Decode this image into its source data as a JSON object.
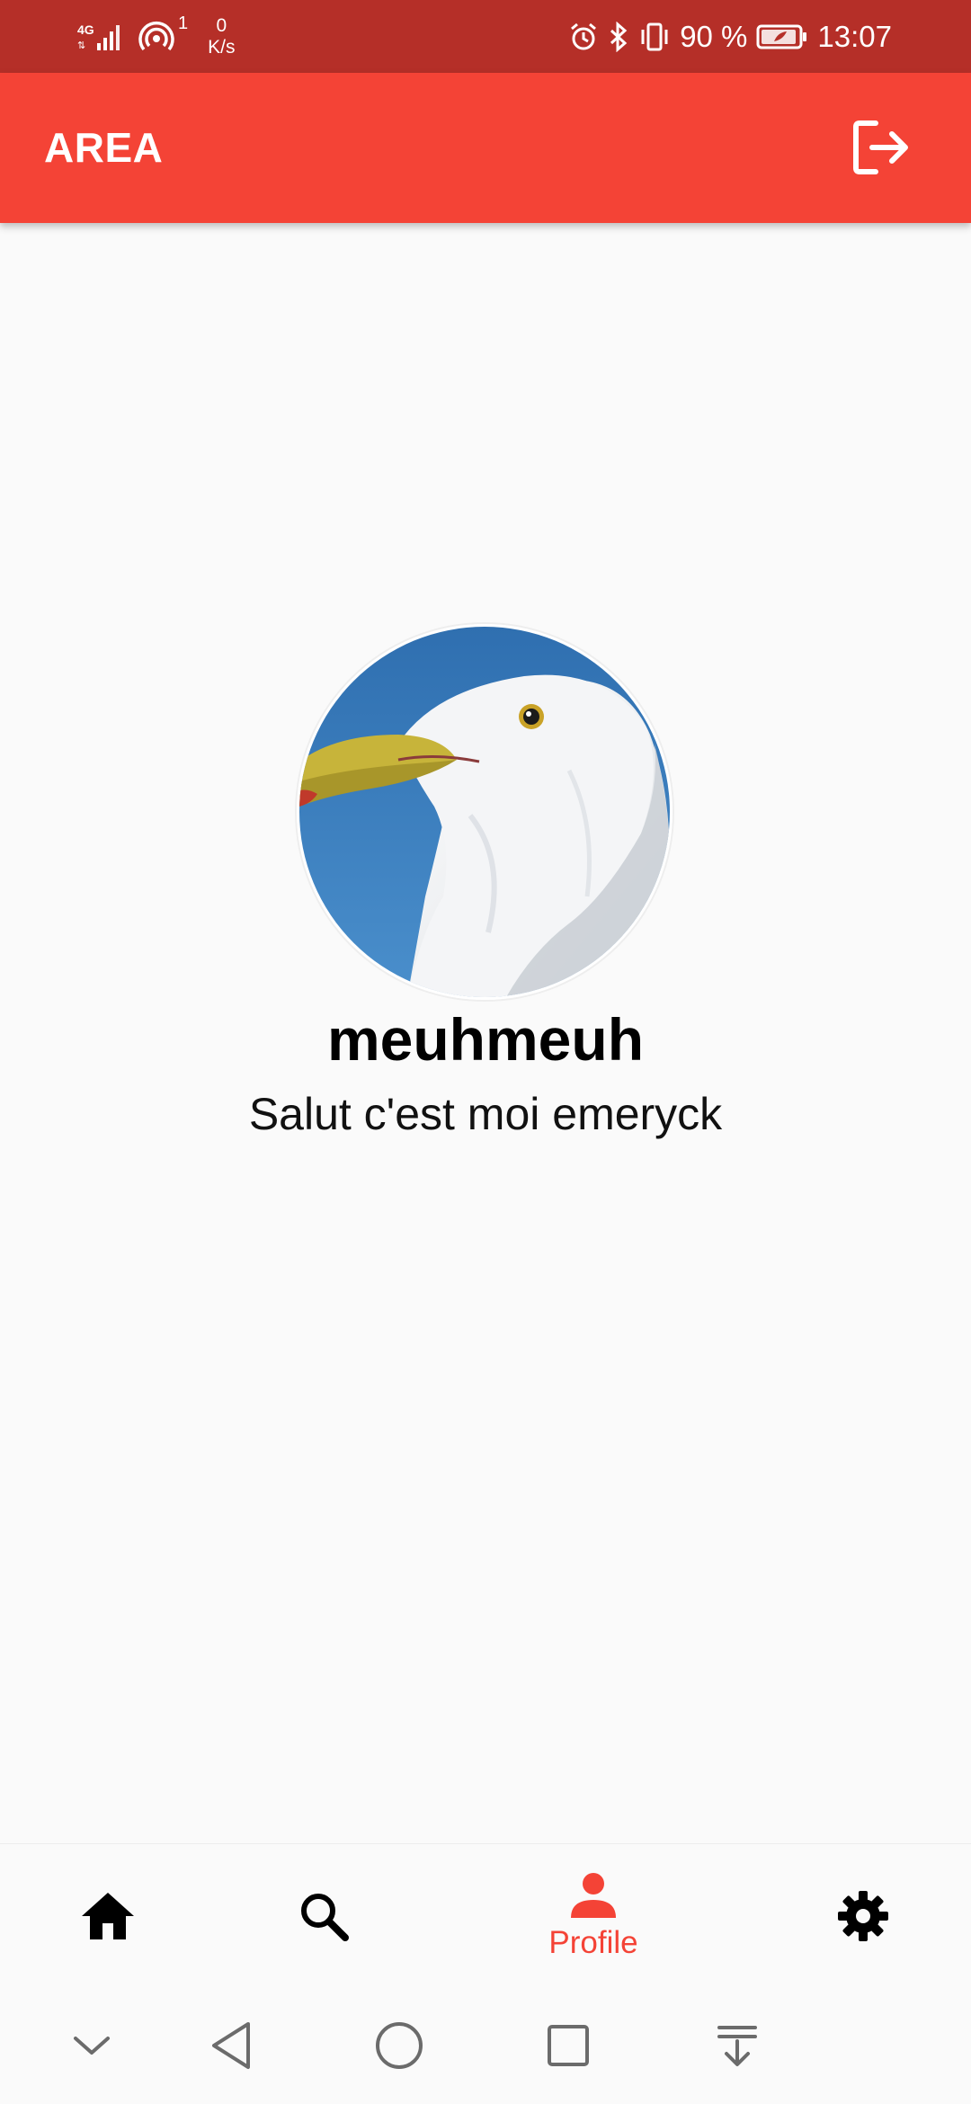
{
  "status_bar": {
    "network_type": "4G",
    "hotspot_count": "1",
    "speed_value": "0",
    "speed_unit": "K/s",
    "battery_percent": "90 %",
    "time": "13:07"
  },
  "app_bar": {
    "title": "AREA",
    "logout_icon": "logout-icon"
  },
  "profile": {
    "username": "meuhmeuh",
    "bio": "Salut c'est moi emeryck",
    "avatar_subject": "seagull"
  },
  "bottom_nav": {
    "items": [
      {
        "icon": "home-icon",
        "label": ""
      },
      {
        "icon": "search-icon",
        "label": ""
      },
      {
        "icon": "person-icon",
        "label": "Profile",
        "active": true
      },
      {
        "icon": "gear-icon",
        "label": ""
      }
    ]
  },
  "system_nav": {
    "buttons": [
      "chevron-down-icon",
      "back-icon",
      "home-circle-icon",
      "recents-icon",
      "notification-pull-icon"
    ]
  },
  "colors": {
    "status_bar": "#b52f28",
    "app_bar": "#f44336",
    "accent": "#f44336",
    "background": "#fafafa"
  }
}
